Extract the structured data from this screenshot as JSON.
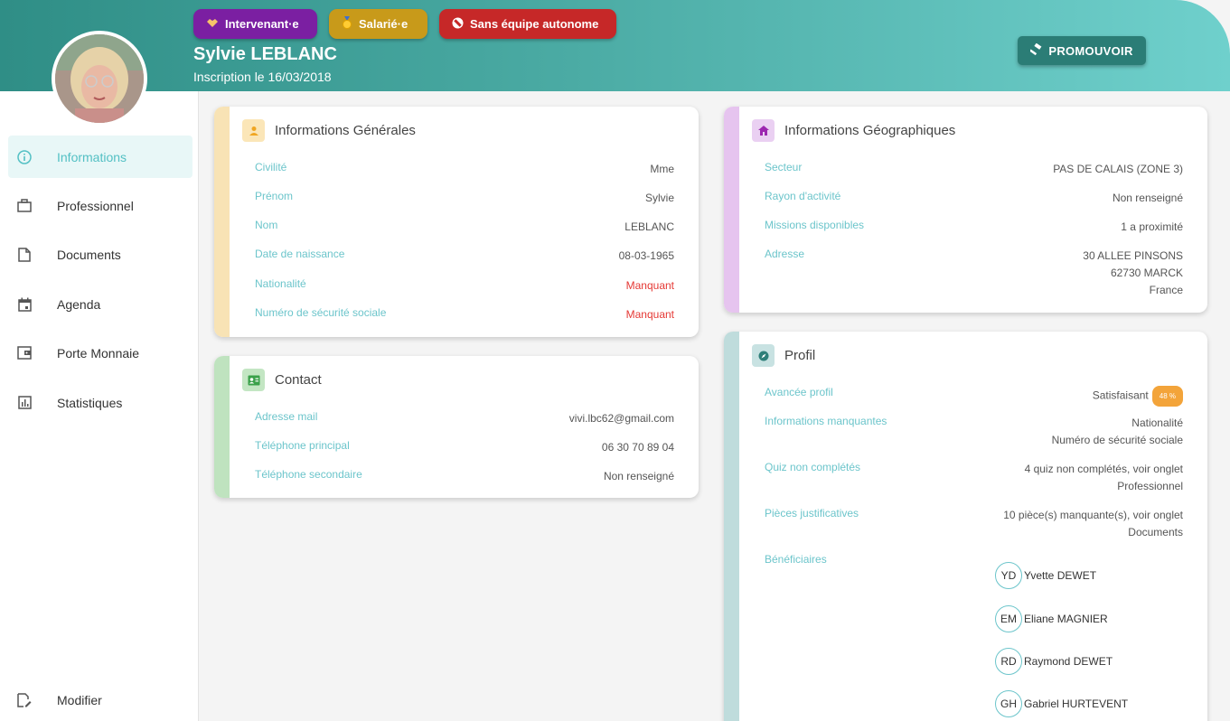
{
  "header": {
    "badges": [
      {
        "label": "Intervenant·e",
        "icon": "handshake-icon",
        "color": "#7b1fa2"
      },
      {
        "label": "Salarié·e",
        "icon": "medal-icon",
        "color": "#c89a1a"
      },
      {
        "label": "Sans équipe autonome",
        "icon": "block-icon",
        "color": "#c62828"
      }
    ],
    "name": "Sylvie LEBLANC",
    "registered": "Inscription le 16/03/2018",
    "promote_label": "PROMOUVOIR"
  },
  "sidebar": {
    "items": [
      {
        "label": "Informations",
        "icon": "info-icon",
        "active": true
      },
      {
        "label": "Professionnel",
        "icon": "briefcase-icon"
      },
      {
        "label": "Documents",
        "icon": "document-icon"
      },
      {
        "label": "Agenda",
        "icon": "calendar-icon"
      },
      {
        "label": "Porte Monnaie",
        "icon": "wallet-icon"
      },
      {
        "label": "Statistiques",
        "icon": "chart-icon"
      }
    ],
    "edit_label": "Modifier"
  },
  "general": {
    "title": "Informations Générales",
    "accent": "#f8e3b5",
    "rows": [
      {
        "label": "Civilité",
        "value": "Mme"
      },
      {
        "label": "Prénom",
        "value": "Sylvie"
      },
      {
        "label": "Nom",
        "value": "LEBLANC"
      },
      {
        "label": "Date de naissance",
        "value": "08-03-1965"
      },
      {
        "label": "Nationalité",
        "value": "Manquant"
      },
      {
        "label": "Numéro de sécurité sociale",
        "value": "Manquant"
      }
    ]
  },
  "contact": {
    "title": "Contact",
    "accent": "#bfe3bf",
    "rows": [
      {
        "label": "Adresse mail",
        "value": "vivi.lbc62@gmail.com"
      },
      {
        "label": "Téléphone principal",
        "value": "06 30 70 89 04"
      },
      {
        "label": "Téléphone secondaire",
        "value": "Non renseigné"
      }
    ]
  },
  "geo": {
    "title": "Informations Géographiques",
    "accent": "#e6c4ef",
    "rows": [
      {
        "label": "Secteur",
        "value": "PAS DE CALAIS (ZONE 3)"
      },
      {
        "label": "Rayon d'activité",
        "value": "Non renseigné"
      },
      {
        "label": "Missions disponibles",
        "value": "1 a proximité"
      }
    ],
    "address_label": "Adresse",
    "address": [
      "30 ALLEE PINSONS",
      "62730 MARCK",
      "France"
    ]
  },
  "profile": {
    "title": "Profil",
    "accent": "#bfdcdc",
    "progress_label": "Avancée profil",
    "progress_value": "Satisfaisant",
    "progress_pct": "48 %",
    "missing_label": "Informations manquantes",
    "missing": [
      "Nationalité",
      "Numéro de sécurité sociale"
    ],
    "quiz_label": "Quiz non complétés",
    "quiz": [
      "4 quiz non complétés, voir onglet",
      "Professionnel"
    ],
    "pieces_label": "Pièces justificatives",
    "pieces": [
      "10 pièce(s) manquante(s), voir onglet",
      "Documents"
    ],
    "benef_label": "Bénéficiaires",
    "beneficiaries": [
      {
        "initials": "YD",
        "name": "Yvette DEWET"
      },
      {
        "initials": "EM",
        "name": "Eliane MAGNIER"
      },
      {
        "initials": "RD",
        "name": "Raymond DEWET"
      },
      {
        "initials": "GH",
        "name": "Gabriel HURTEVENT"
      }
    ]
  }
}
